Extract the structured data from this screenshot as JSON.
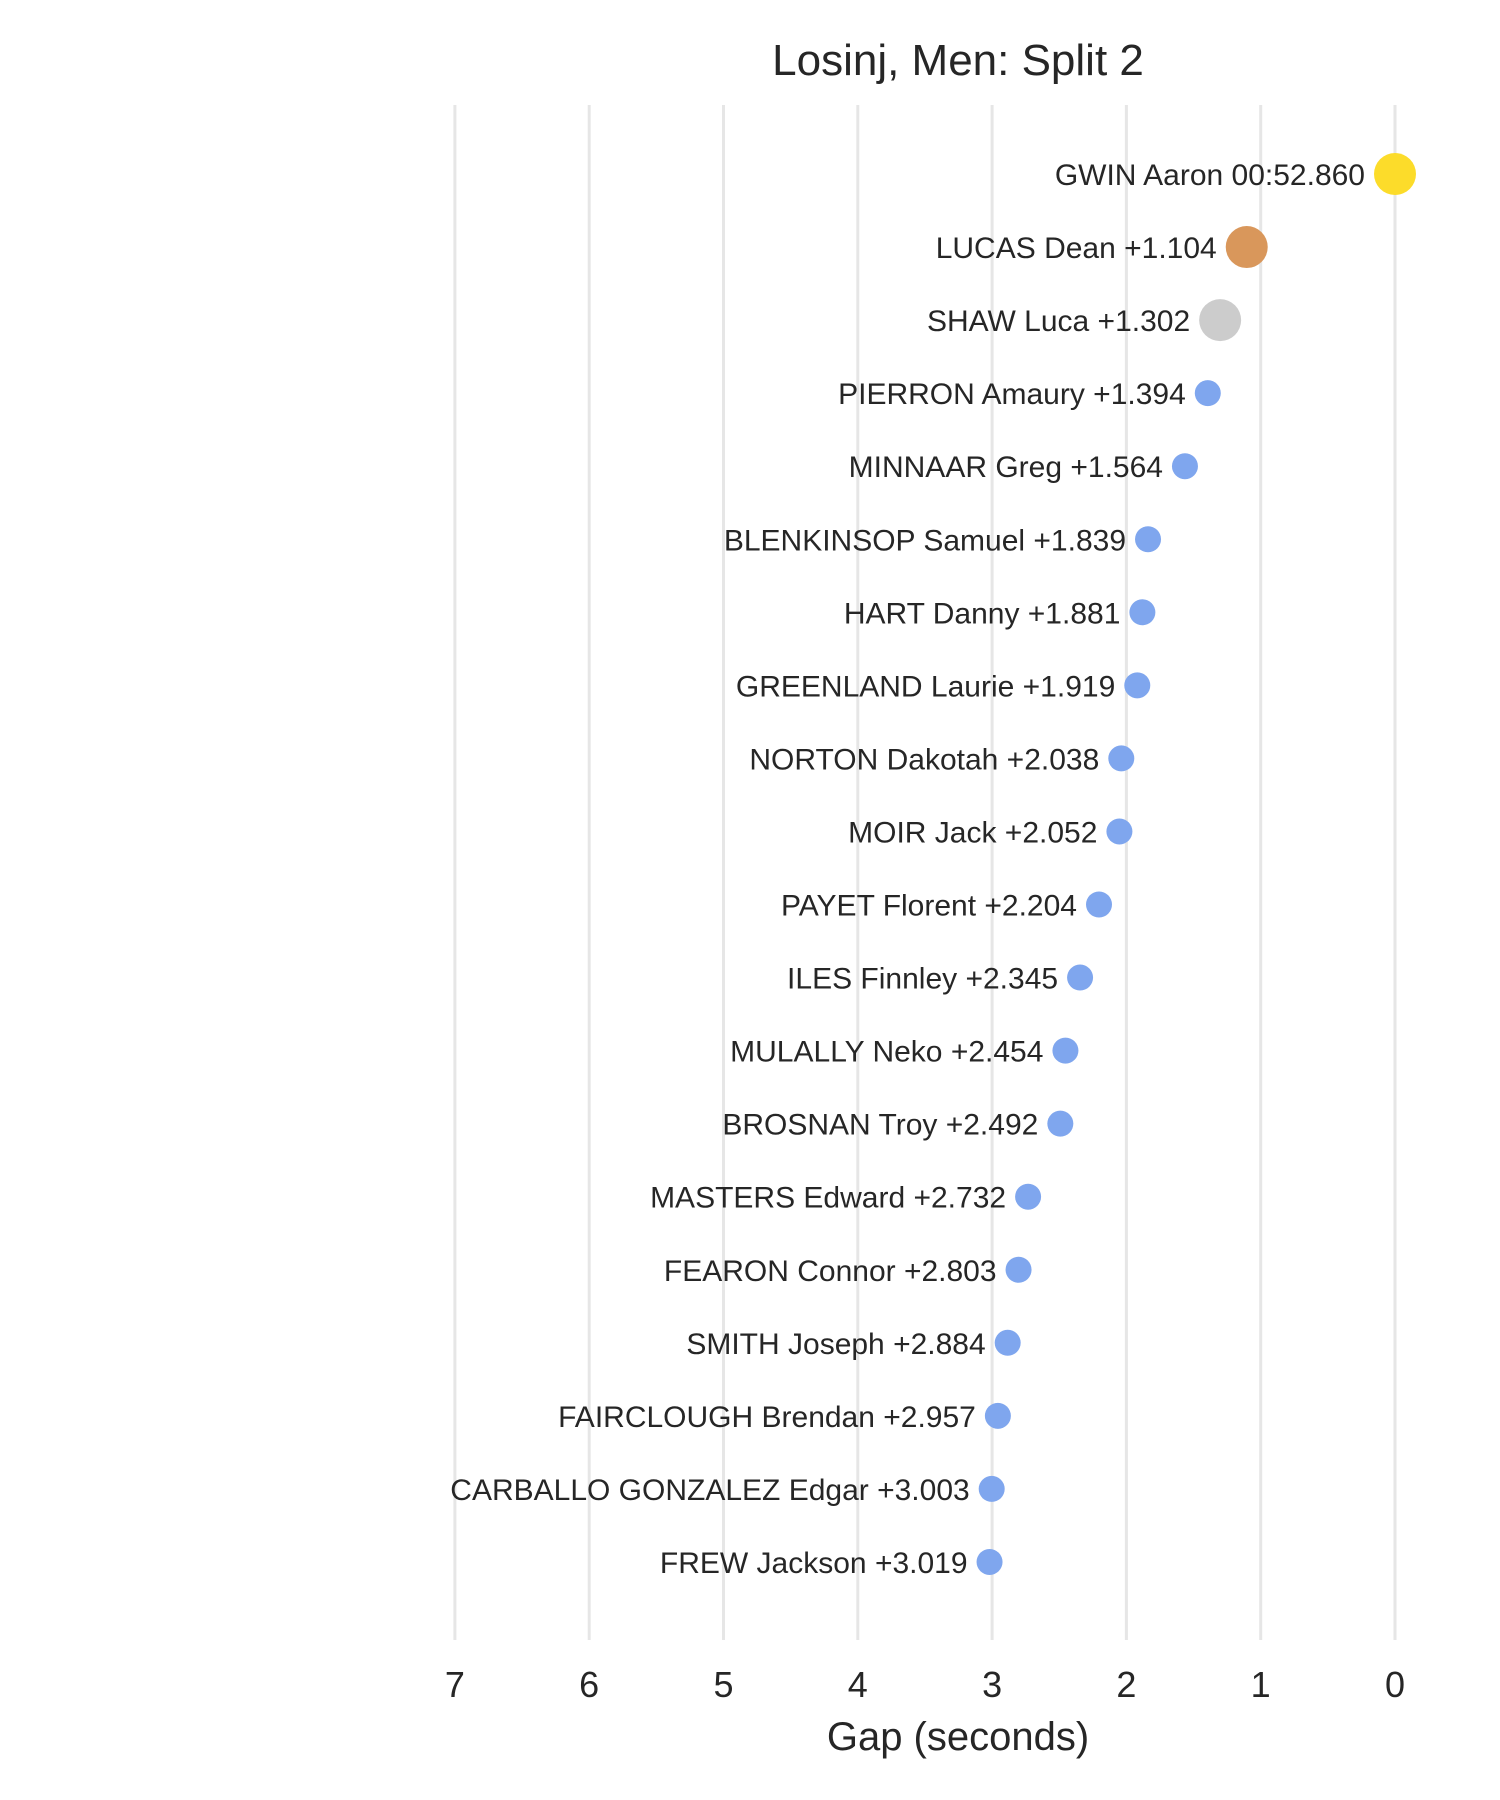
{
  "chart_data": {
    "type": "scatter",
    "title": "Losinj, Men: Split 2",
    "xlabel": "Gap (seconds)",
    "ylabel": "",
    "xlim": [
      7,
      0
    ],
    "x_ticks": [
      "7",
      "6",
      "5",
      "4",
      "3",
      "2",
      "1",
      "0"
    ],
    "x_tick_values": [
      7,
      6,
      5,
      4,
      3,
      2,
      1,
      0
    ],
    "grid": "vertical",
    "colors": {
      "gold": "#fcdc2a",
      "silver": "#cccccc",
      "bronze": "#d9975b",
      "other": "#7fa6ee"
    },
    "points": [
      {
        "label": "GWIN Aaron 00:52.860",
        "gap": 0.0,
        "rank": 1,
        "marker": "gold"
      },
      {
        "label": "LUCAS Dean +1.104",
        "gap": 1.104,
        "rank": 2,
        "marker": "bronze"
      },
      {
        "label": "SHAW Luca +1.302",
        "gap": 1.302,
        "rank": 3,
        "marker": "silver"
      },
      {
        "label": "PIERRON Amaury +1.394",
        "gap": 1.394,
        "rank": 4,
        "marker": "other"
      },
      {
        "label": "MINNAAR Greg +1.564",
        "gap": 1.564,
        "rank": 5,
        "marker": "other"
      },
      {
        "label": "BLENKINSOP Samuel +1.839",
        "gap": 1.839,
        "rank": 6,
        "marker": "other"
      },
      {
        "label": "HART Danny +1.881",
        "gap": 1.881,
        "rank": 7,
        "marker": "other"
      },
      {
        "label": "GREENLAND Laurie +1.919",
        "gap": 1.919,
        "rank": 8,
        "marker": "other"
      },
      {
        "label": "NORTON Dakotah +2.038",
        "gap": 2.038,
        "rank": 9,
        "marker": "other"
      },
      {
        "label": "MOIR Jack +2.052",
        "gap": 2.052,
        "rank": 10,
        "marker": "other"
      },
      {
        "label": "PAYET Florent +2.204",
        "gap": 2.204,
        "rank": 11,
        "marker": "other"
      },
      {
        "label": "ILES Finnley +2.345",
        "gap": 2.345,
        "rank": 12,
        "marker": "other"
      },
      {
        "label": "MULALLY Neko +2.454",
        "gap": 2.454,
        "rank": 13,
        "marker": "other"
      },
      {
        "label": "BROSNAN Troy +2.492",
        "gap": 2.492,
        "rank": 14,
        "marker": "other"
      },
      {
        "label": "MASTERS Edward +2.732",
        "gap": 2.732,
        "rank": 15,
        "marker": "other"
      },
      {
        "label": "FEARON Connor +2.803",
        "gap": 2.803,
        "rank": 16,
        "marker": "other"
      },
      {
        "label": "SMITH Joseph +2.884",
        "gap": 2.884,
        "rank": 17,
        "marker": "other"
      },
      {
        "label": "FAIRCLOUGH Brendan +2.957",
        "gap": 2.957,
        "rank": 18,
        "marker": "other"
      },
      {
        "label": "CARBALLO GONZALEZ Edgar +3.003",
        "gap": 3.003,
        "rank": 19,
        "marker": "other"
      },
      {
        "label": "FREW Jackson +3.019",
        "gap": 3.019,
        "rank": 20,
        "marker": "other"
      }
    ]
  }
}
